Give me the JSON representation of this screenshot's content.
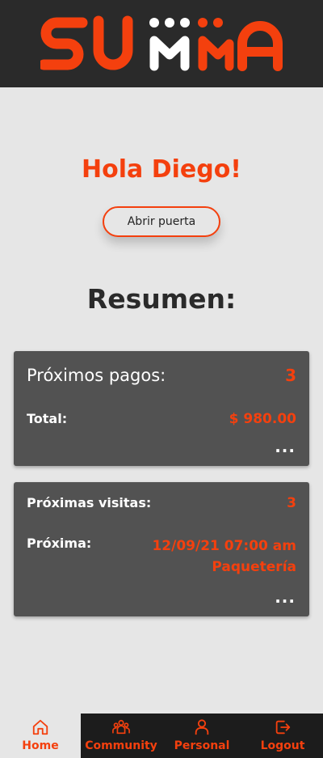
{
  "header": {
    "logo_text": "SUMMA",
    "brand_color": "#f4400e"
  },
  "main": {
    "greeting": "Hola Diego!",
    "open_door_label": "Abrir puerta",
    "summary_title": "Resumen:"
  },
  "payments_card": {
    "title": "Próximos pagos:",
    "count": "3",
    "total_label": "Total:",
    "total_value": "$ 980.00",
    "more": "..."
  },
  "visits_card": {
    "title": "Próximas visitas:",
    "count": "3",
    "next_label": "Próxima:",
    "next_datetime": "12/09/21 07:00 am",
    "next_type": "Paquetería",
    "more": "..."
  },
  "tabbar": {
    "items": [
      {
        "label": "Home",
        "icon": "home-icon",
        "active": true
      },
      {
        "label": "Community",
        "icon": "community-icon",
        "active": false
      },
      {
        "label": "Personal",
        "icon": "person-icon",
        "active": false
      },
      {
        "label": "Logout",
        "icon": "logout-icon",
        "active": false
      }
    ]
  }
}
